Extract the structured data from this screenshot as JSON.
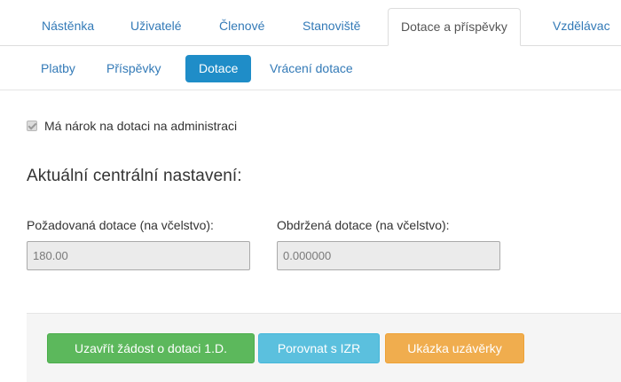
{
  "top_tabs": [
    {
      "label": "Nástěnka",
      "active": false
    },
    {
      "label": "Uživatelé",
      "active": false
    },
    {
      "label": "Členové",
      "active": false
    },
    {
      "label": "Stanoviště",
      "active": false
    },
    {
      "label": "Dotace a příspěvky",
      "active": true
    },
    {
      "label": "Vzdělávac",
      "active": false
    }
  ],
  "sub_tabs": [
    {
      "label": "Platby",
      "active": false
    },
    {
      "label": "Příspěvky",
      "active": false
    },
    {
      "label": "Dotace",
      "active": true
    },
    {
      "label": "Vrácení dotace",
      "active": false
    }
  ],
  "eligibility": {
    "label": "Má nárok na dotaci na administraci",
    "checked": true,
    "disabled": true
  },
  "section": {
    "heading": "Aktuální centrální nastavení:"
  },
  "fields": {
    "requested": {
      "label": "Požadovaná dotace (na včelstvo):",
      "value": "180.00"
    },
    "received": {
      "label": "Obdržená dotace (na včelstvo):",
      "value": "0.000000"
    }
  },
  "actions": {
    "close_request": "Uzavřít žádost o dotaci 1.D.",
    "compare": "Porovnat s IZR",
    "preview": "Ukázka uzávěrky"
  },
  "colors": {
    "link": "#337ab7",
    "active_pill": "#1f8dc8",
    "btn_success": "#5cb85c",
    "btn_info": "#5bc0de",
    "btn_warning": "#f0ad4e"
  }
}
